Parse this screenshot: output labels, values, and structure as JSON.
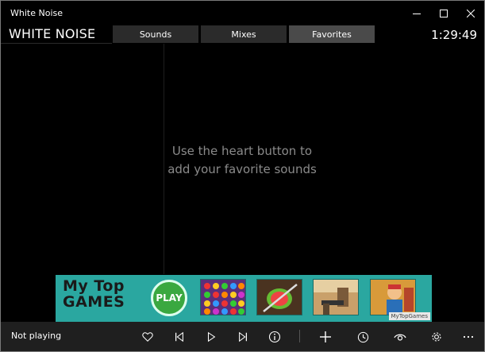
{
  "window": {
    "title": "White Noise"
  },
  "header": {
    "app_name": "WHITE NOISE",
    "tabs": [
      {
        "label": "Sounds",
        "active": false
      },
      {
        "label": "Mixes",
        "active": false
      },
      {
        "label": "Favorites",
        "active": true
      }
    ],
    "clock": "1:29:49"
  },
  "main": {
    "empty_line1": "Use the heart button to",
    "empty_line2": "add your favorite sounds"
  },
  "ad": {
    "logo_line1": "My Top",
    "logo_line2": "Games",
    "play_label": "PLAY",
    "brand": "MyTopGames"
  },
  "footer": {
    "status": "Not playing",
    "buttons": [
      "heart-icon",
      "previous-icon",
      "play-icon",
      "next-icon",
      "info-icon",
      "add-icon",
      "timer-icon",
      "eye-icon",
      "settings-icon",
      "more-icon"
    ]
  },
  "colors": {
    "accent_tab": "#4a4a4a",
    "tab": "#2b2b2b",
    "footer": "#1f1f1f",
    "ad_bg": "#2aa7a0"
  }
}
